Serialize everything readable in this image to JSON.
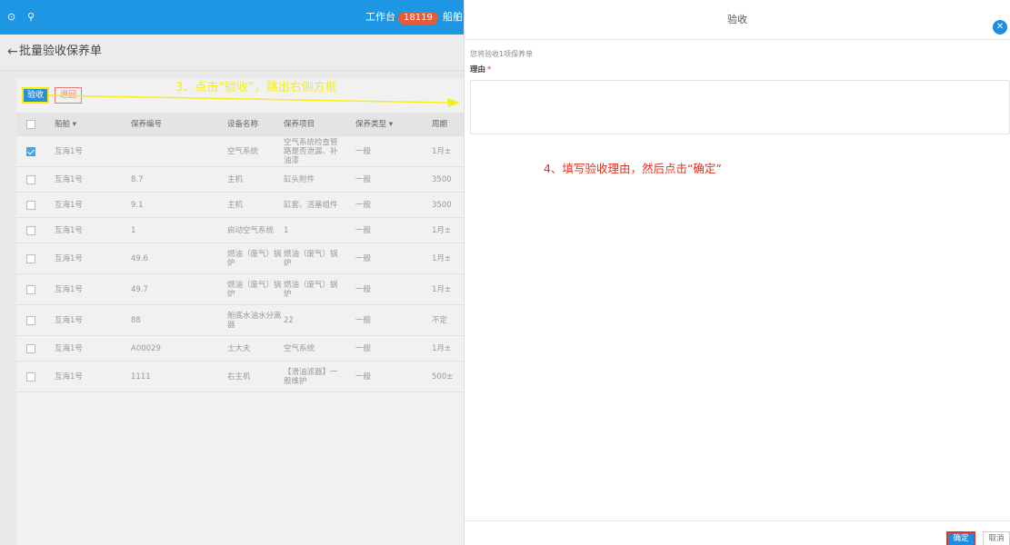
{
  "topbar": {
    "workbench_label": "工作台",
    "workbench_count": "18119",
    "ship_nav_partial": "船舶"
  },
  "page": {
    "title": "批量验收保养单"
  },
  "toolbar": {
    "accept_label": "验收",
    "reject_label": "退回"
  },
  "table": {
    "columns": [
      "船舶 ▾",
      "保养编号",
      "设备名称",
      "保养项目",
      "保养类型 ▾",
      "周期"
    ],
    "rows": [
      {
        "checked": true,
        "ship": "互海1号",
        "code": "",
        "device": "空气系统",
        "item": "空气系统检查管路是否泄漏、补油漆",
        "type": "一般",
        "cycle": "1月±"
      },
      {
        "checked": false,
        "ship": "互海1号",
        "code": "8.7",
        "device": "主机",
        "item": "缸头附件",
        "type": "一般",
        "cycle": "3500"
      },
      {
        "checked": false,
        "ship": "互海1号",
        "code": "9.1",
        "device": "主机",
        "item": "缸套、活塞组件",
        "type": "一般",
        "cycle": "3500"
      },
      {
        "checked": false,
        "ship": "互海1号",
        "code": "1",
        "device": "启动空气系统",
        "item": "1",
        "type": "一般",
        "cycle": "1月±"
      },
      {
        "checked": false,
        "ship": "互海1号",
        "code": "49.6",
        "device": "燃油（废气）锅炉",
        "item": "燃油（废气）锅炉",
        "type": "一般",
        "cycle": "1月±"
      },
      {
        "checked": false,
        "ship": "互海1号",
        "code": "49.7",
        "device": "燃油（废气）锅炉",
        "item": "燃油（废气）锅炉",
        "type": "一般",
        "cycle": "1月±"
      },
      {
        "checked": false,
        "ship": "互海1号",
        "code": "88",
        "device": "舱底水油水分离器",
        "item": "22",
        "type": "一般",
        "cycle": "不定"
      },
      {
        "checked": false,
        "ship": "互海1号",
        "code": "A00029",
        "device": "士大夫",
        "item": "空气系统",
        "type": "一般",
        "cycle": "1月±"
      },
      {
        "checked": false,
        "ship": "互海1号",
        "code": "1111",
        "device": "右主机",
        "item": "【滑油滤器】一般维护",
        "type": "一般",
        "cycle": "500±"
      }
    ]
  },
  "annotations": {
    "step3": "3、点击“验收”，跳出右侧方框",
    "step4": "4、填写验收理由，然后点击“确定”",
    "color_step3": "#f6ef16",
    "color_step4": "#e0301e"
  },
  "drawer": {
    "title": "验收",
    "description": "您将验收1项保养单",
    "reason_label": "理由",
    "required_mark": "*",
    "reason_value": "",
    "confirm_label": "确定",
    "cancel_label": "取消"
  },
  "colors": {
    "brand_blue": "#1d97e3",
    "badge_red": "#e95a3a"
  },
  "icons": {
    "close": "close-circle-icon",
    "back": "back-arrow-icon",
    "search": "search-icon"
  }
}
